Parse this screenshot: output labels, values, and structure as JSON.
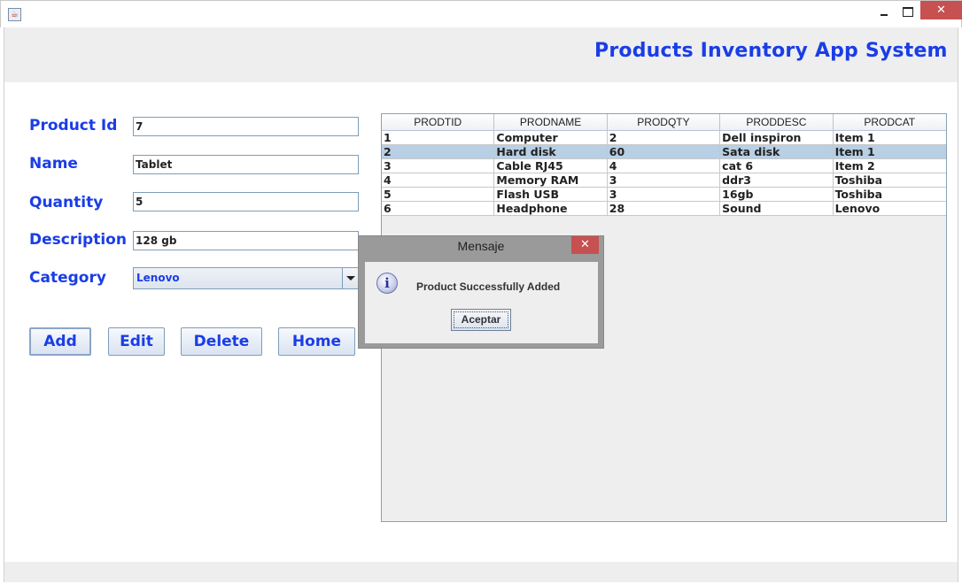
{
  "window": {
    "icon": "java-cup-icon",
    "minimize_label": "",
    "close_label": "✕"
  },
  "header": {
    "title": "Products Inventory App System"
  },
  "form": {
    "product_id": {
      "label": "Product Id",
      "value": "7"
    },
    "name": {
      "label": "Name",
      "value": "Tablet"
    },
    "quantity": {
      "label": "Quantity",
      "value": "5"
    },
    "description": {
      "label": "Description",
      "value": "128 gb"
    },
    "category": {
      "label": "Category",
      "value": "Lenovo"
    }
  },
  "buttons": {
    "add": "Add",
    "edit": "Edit",
    "delete": "Delete",
    "home": "Home"
  },
  "table": {
    "columns": [
      "PRODTID",
      "PRODNAME",
      "PRODQTY",
      "PRODDESC",
      "PRODCAT"
    ],
    "rows": [
      [
        "1",
        "Computer",
        "2",
        "Dell inspiron",
        "Item 1"
      ],
      [
        "2",
        "Hard disk",
        "60",
        "Sata disk",
        "Item 1"
      ],
      [
        "3",
        "Cable RJ45",
        "4",
        "cat 6",
        "Item 2"
      ],
      [
        "4",
        "Memory RAM",
        "3",
        "ddr3",
        "Toshiba"
      ],
      [
        "5",
        "Flash USB",
        "3",
        "16gb",
        "Toshiba"
      ],
      [
        "6",
        "Headphone",
        "28",
        "Sound",
        "Lenovo"
      ]
    ],
    "selected_row": 1
  },
  "dialog": {
    "title": "Mensaje",
    "close_label": "✕",
    "icon": "info-icon",
    "icon_glyph": "i",
    "message": "Product Successfully Added",
    "ok_label": "Aceptar"
  },
  "colors": {
    "accent": "#1a3de6",
    "selection": "#b8cfe5",
    "close_red": "#c75050"
  }
}
